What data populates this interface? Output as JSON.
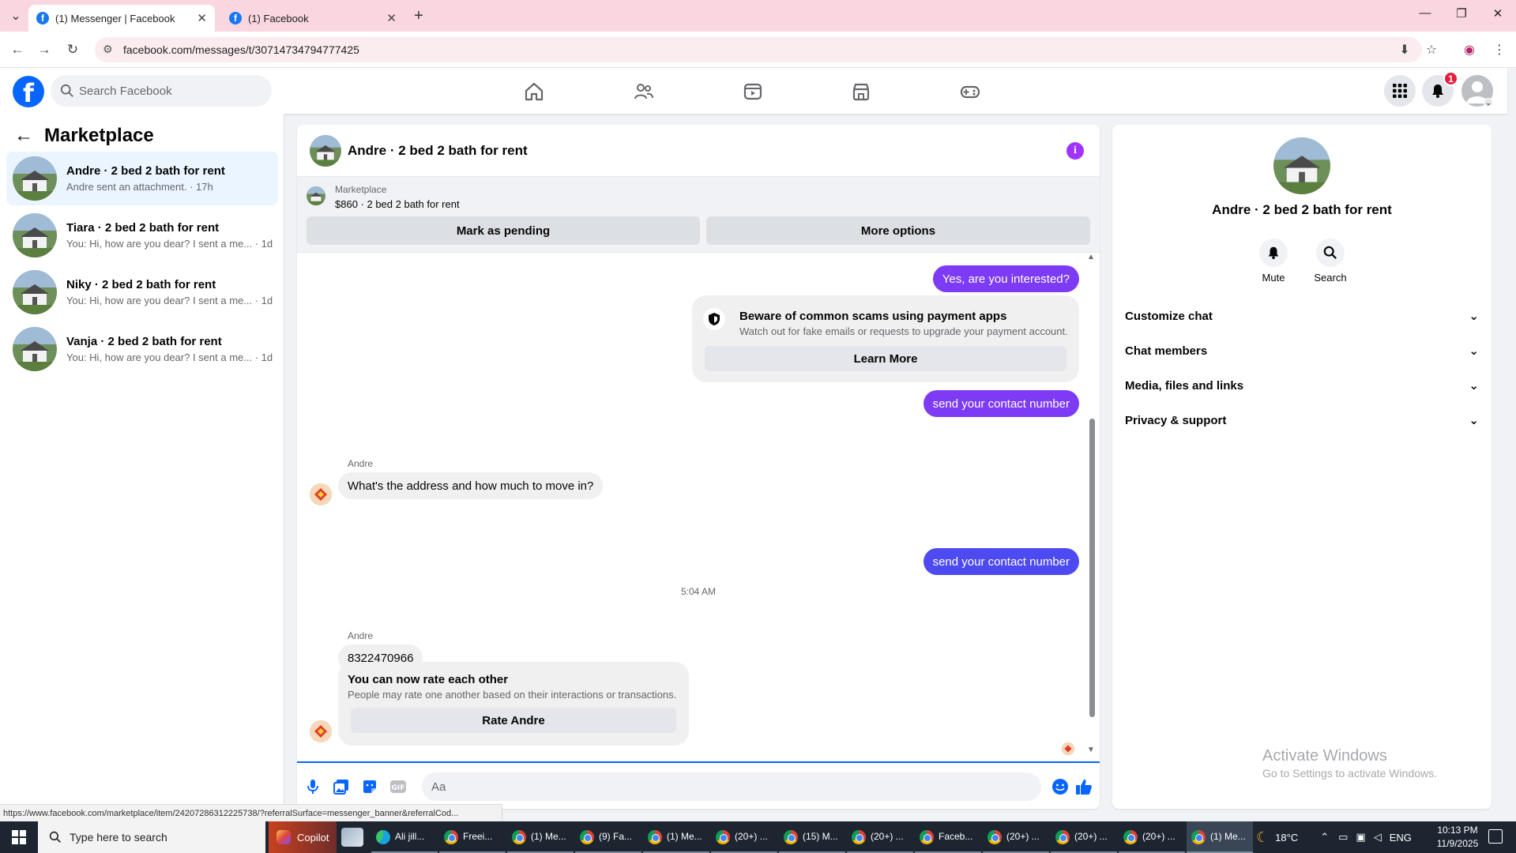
{
  "browser": {
    "tabs": [
      {
        "title": "(1) Messenger | Facebook",
        "active": true
      },
      {
        "title": "(1) Facebook",
        "active": false
      }
    ],
    "url": "facebook.com/messages/t/30714734794777425",
    "new_tab": "+",
    "tab_close": "✕"
  },
  "fb": {
    "search_placeholder": "Search Facebook",
    "notification_count": "1",
    "logo_letter": "f"
  },
  "sidebar": {
    "title": "Marketplace",
    "conversations": [
      {
        "title": "Andre · 2 bed 2 bath for rent",
        "preview": "Andre sent an attachment. · 17h",
        "active": true
      },
      {
        "title": "Tiara · 2 bed 2 bath for rent",
        "preview": "You: Hi, how are you dear? I sent a me... · 1d",
        "active": false
      },
      {
        "title": "Niky · 2 bed 2 bath for rent",
        "preview": "You: Hi, how are you dear? I sent a me... · 1d",
        "active": false
      },
      {
        "title": "Vanja · 2 bed 2 bath for rent",
        "preview": "You: Hi, how are you dear? I sent a me... · 1d",
        "active": false
      }
    ]
  },
  "chat": {
    "header_name": "Andre · 2 bed 2 bath for rent",
    "info_glyph": "i",
    "banner": {
      "label": "Marketplace",
      "listing": "$860 · 2 bed 2 bath for rent",
      "mark_pending": "Mark as pending",
      "more_options": "More options"
    },
    "messages": {
      "out1": "Yes, are you interested?",
      "scam_title": "Beware of common scams using payment apps",
      "scam_sub": "Watch out for fake emails or requests to upgrade your payment account.",
      "learn_more": "Learn More",
      "out2": "send your contact number",
      "sender1": "Andre",
      "in1": "What's the address and how much to move in?",
      "out3": "send your contact number",
      "timestamp": "5:04 AM",
      "sender2": "Andre",
      "in2": "8322470966",
      "rate_title": "You can now rate each other",
      "rate_sub": "People may rate one another based on their interactions or transactions.",
      "rate_btn": "Rate Andre"
    },
    "composer_placeholder": "Aa",
    "composer_value": ""
  },
  "info_panel": {
    "name": "Andre · 2 bed 2 bath for rent",
    "actions": [
      {
        "label": "Mute"
      },
      {
        "label": "Search"
      }
    ],
    "rows": [
      "Customize chat",
      "Chat members",
      "Media, files and links",
      "Privacy & support"
    ],
    "watermark_title": "Activate Windows",
    "watermark_sub": "Go to Settings to activate Windows."
  },
  "status_url": "https://www.facebook.com/marketplace/item/24207286312225738/?referralSurface=messenger_banner&referralCod...",
  "taskbar": {
    "search_placeholder": "Type here to search",
    "copilot": "Copilot",
    "apps": [
      "Ali jill...",
      "Freei...",
      "(1) Me...",
      "(9) Fa...",
      "(1) Me...",
      "(20+) ...",
      "(15) M...",
      "(20+) ...",
      "Faceb...",
      "(20+) ...",
      "(20+) ...",
      "(20+) ...",
      "(1) Me..."
    ],
    "weather": "18°C",
    "lang": "ENG",
    "time": "10:13 PM",
    "date": "11/9/2025"
  },
  "colors": {
    "fb_blue": "#0866ff",
    "bubble_purple": "#7d3bf6",
    "bubble_blue": "#4d4af2",
    "tab_strip_pink": "#f9d6e0"
  }
}
